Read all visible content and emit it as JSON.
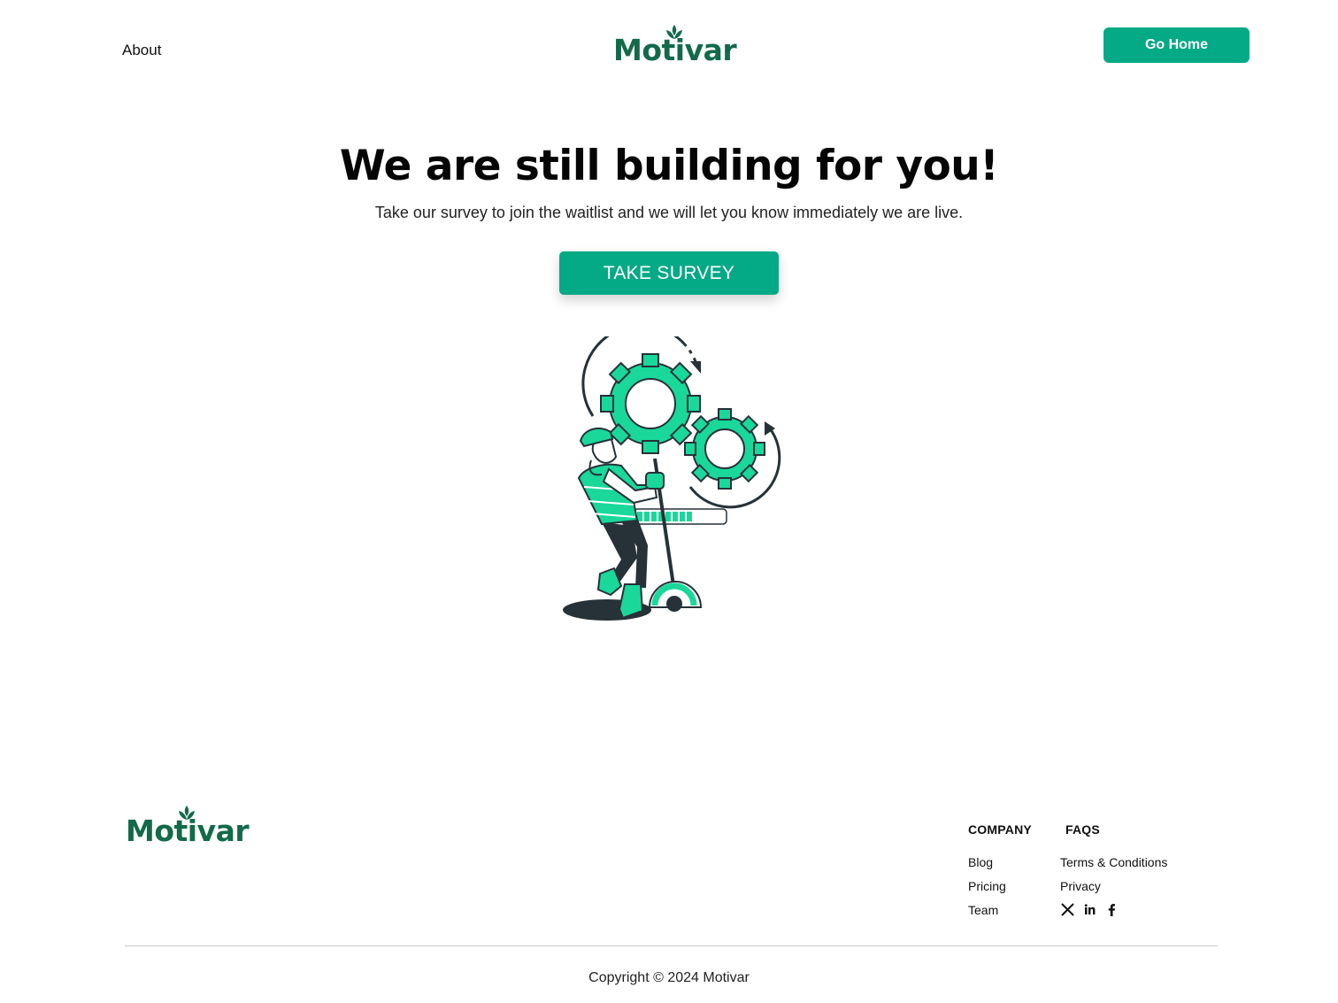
{
  "header": {
    "about_label": "About",
    "logo_text": "Motivar",
    "go_home_label": "Go Home"
  },
  "hero": {
    "title": "We are still building for you!",
    "subtitle": "Take our survey to join the waitlist and we will let you know immediately we are live.",
    "cta_label": "TAKE SURVEY"
  },
  "footer": {
    "logo_text": "Motivar",
    "company": {
      "heading": "COMPANY",
      "links": [
        "Blog",
        "Pricing",
        "Team"
      ]
    },
    "faqs": {
      "heading": "FAQS",
      "links": [
        "Terms & Conditions",
        "Privacy"
      ]
    },
    "social": [
      "x-icon",
      "linkedin-icon",
      "facebook-icon"
    ],
    "copyright": "Copyright © 2024 Motivar"
  },
  "colors": {
    "brand": "#136a4b",
    "accent": "#04a985",
    "illustration_green": "#19d89a",
    "illustration_dark": "#263238"
  }
}
